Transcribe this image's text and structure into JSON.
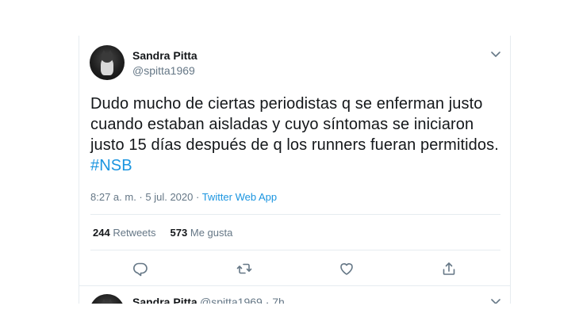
{
  "tweet": {
    "author_name": "Sandra Pitta",
    "author_handle": "@spitta1969",
    "text_main": "Dudo mucho de ciertas periodistas q se enferman justo cuando estaban aisladas y cuyo síntomas se iniciaron justo 15 días después de q los runners fueran permitidos. ",
    "hashtag": "#NSB",
    "time": "8:27 a. m.",
    "separator": " · ",
    "date": "5 jul. 2020",
    "app": "Twitter Web App",
    "retweets_count": "244",
    "retweets_label": "Retweets",
    "likes_count": "573",
    "likes_label": "Me gusta"
  },
  "next_tweet": {
    "author_name": "Sandra Pitta",
    "handle_time": "@spitta1969 · 7h"
  },
  "icons": {
    "menu": "chevron-down-icon",
    "reply": "reply-icon",
    "retweet": "retweet-icon",
    "like": "heart-icon",
    "share": "share-icon"
  },
  "colors": {
    "text": "#14171a",
    "secondary": "#657786",
    "link": "#1b95e0",
    "divider": "#e6ecf0"
  }
}
